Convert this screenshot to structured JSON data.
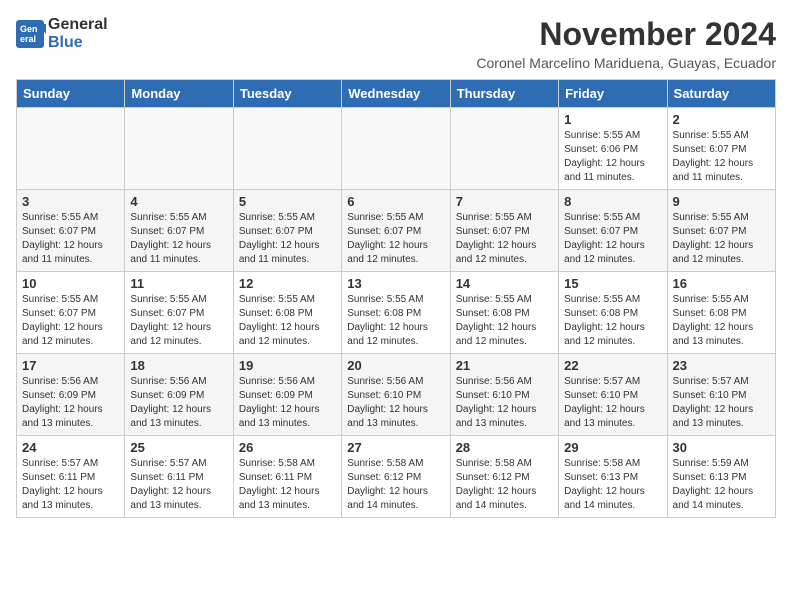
{
  "logo": {
    "general": "General",
    "blue": "Blue"
  },
  "title": "November 2024",
  "location": "Coronel Marcelino Mariduena, Guayas, Ecuador",
  "weekdays": [
    "Sunday",
    "Monday",
    "Tuesday",
    "Wednesday",
    "Thursday",
    "Friday",
    "Saturday"
  ],
  "weeks": [
    [
      {
        "day": "",
        "info": ""
      },
      {
        "day": "",
        "info": ""
      },
      {
        "day": "",
        "info": ""
      },
      {
        "day": "",
        "info": ""
      },
      {
        "day": "",
        "info": ""
      },
      {
        "day": "1",
        "info": "Sunrise: 5:55 AM\nSunset: 6:06 PM\nDaylight: 12 hours and 11 minutes."
      },
      {
        "day": "2",
        "info": "Sunrise: 5:55 AM\nSunset: 6:07 PM\nDaylight: 12 hours and 11 minutes."
      }
    ],
    [
      {
        "day": "3",
        "info": "Sunrise: 5:55 AM\nSunset: 6:07 PM\nDaylight: 12 hours and 11 minutes."
      },
      {
        "day": "4",
        "info": "Sunrise: 5:55 AM\nSunset: 6:07 PM\nDaylight: 12 hours and 11 minutes."
      },
      {
        "day": "5",
        "info": "Sunrise: 5:55 AM\nSunset: 6:07 PM\nDaylight: 12 hours and 11 minutes."
      },
      {
        "day": "6",
        "info": "Sunrise: 5:55 AM\nSunset: 6:07 PM\nDaylight: 12 hours and 12 minutes."
      },
      {
        "day": "7",
        "info": "Sunrise: 5:55 AM\nSunset: 6:07 PM\nDaylight: 12 hours and 12 minutes."
      },
      {
        "day": "8",
        "info": "Sunrise: 5:55 AM\nSunset: 6:07 PM\nDaylight: 12 hours and 12 minutes."
      },
      {
        "day": "9",
        "info": "Sunrise: 5:55 AM\nSunset: 6:07 PM\nDaylight: 12 hours and 12 minutes."
      }
    ],
    [
      {
        "day": "10",
        "info": "Sunrise: 5:55 AM\nSunset: 6:07 PM\nDaylight: 12 hours and 12 minutes."
      },
      {
        "day": "11",
        "info": "Sunrise: 5:55 AM\nSunset: 6:07 PM\nDaylight: 12 hours and 12 minutes."
      },
      {
        "day": "12",
        "info": "Sunrise: 5:55 AM\nSunset: 6:08 PM\nDaylight: 12 hours and 12 minutes."
      },
      {
        "day": "13",
        "info": "Sunrise: 5:55 AM\nSunset: 6:08 PM\nDaylight: 12 hours and 12 minutes."
      },
      {
        "day": "14",
        "info": "Sunrise: 5:55 AM\nSunset: 6:08 PM\nDaylight: 12 hours and 12 minutes."
      },
      {
        "day": "15",
        "info": "Sunrise: 5:55 AM\nSunset: 6:08 PM\nDaylight: 12 hours and 12 minutes."
      },
      {
        "day": "16",
        "info": "Sunrise: 5:55 AM\nSunset: 6:08 PM\nDaylight: 12 hours and 13 minutes."
      }
    ],
    [
      {
        "day": "17",
        "info": "Sunrise: 5:56 AM\nSunset: 6:09 PM\nDaylight: 12 hours and 13 minutes."
      },
      {
        "day": "18",
        "info": "Sunrise: 5:56 AM\nSunset: 6:09 PM\nDaylight: 12 hours and 13 minutes."
      },
      {
        "day": "19",
        "info": "Sunrise: 5:56 AM\nSunset: 6:09 PM\nDaylight: 12 hours and 13 minutes."
      },
      {
        "day": "20",
        "info": "Sunrise: 5:56 AM\nSunset: 6:10 PM\nDaylight: 12 hours and 13 minutes."
      },
      {
        "day": "21",
        "info": "Sunrise: 5:56 AM\nSunset: 6:10 PM\nDaylight: 12 hours and 13 minutes."
      },
      {
        "day": "22",
        "info": "Sunrise: 5:57 AM\nSunset: 6:10 PM\nDaylight: 12 hours and 13 minutes."
      },
      {
        "day": "23",
        "info": "Sunrise: 5:57 AM\nSunset: 6:10 PM\nDaylight: 12 hours and 13 minutes."
      }
    ],
    [
      {
        "day": "24",
        "info": "Sunrise: 5:57 AM\nSunset: 6:11 PM\nDaylight: 12 hours and 13 minutes."
      },
      {
        "day": "25",
        "info": "Sunrise: 5:57 AM\nSunset: 6:11 PM\nDaylight: 12 hours and 13 minutes."
      },
      {
        "day": "26",
        "info": "Sunrise: 5:58 AM\nSunset: 6:11 PM\nDaylight: 12 hours and 13 minutes."
      },
      {
        "day": "27",
        "info": "Sunrise: 5:58 AM\nSunset: 6:12 PM\nDaylight: 12 hours and 14 minutes."
      },
      {
        "day": "28",
        "info": "Sunrise: 5:58 AM\nSunset: 6:12 PM\nDaylight: 12 hours and 14 minutes."
      },
      {
        "day": "29",
        "info": "Sunrise: 5:58 AM\nSunset: 6:13 PM\nDaylight: 12 hours and 14 minutes."
      },
      {
        "day": "30",
        "info": "Sunrise: 5:59 AM\nSunset: 6:13 PM\nDaylight: 12 hours and 14 minutes."
      }
    ]
  ]
}
